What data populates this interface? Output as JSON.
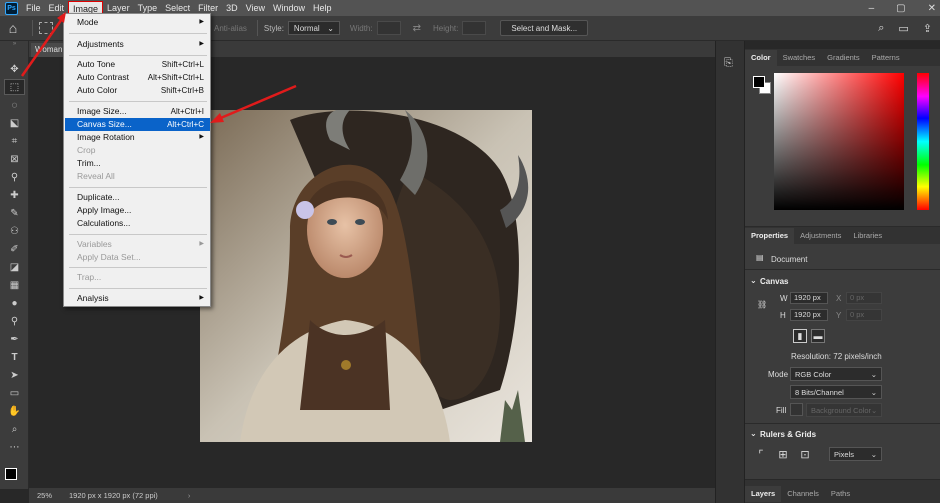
{
  "menubar": {
    "logo": "Ps",
    "items": [
      "File",
      "Edit",
      "Image",
      "Layer",
      "Type",
      "Select",
      "Filter",
      "3D",
      "View",
      "Window",
      "Help"
    ],
    "active_index": 2,
    "window_controls": [
      "–",
      "▢",
      "✕"
    ]
  },
  "options": {
    "anti_alias": "Anti-alias",
    "style_label": "Style:",
    "style_value": "Normal",
    "width_label": "Width:",
    "height_label": "Height:",
    "select_mask": "Select and Mask..."
  },
  "document": {
    "tab_title": "Woman",
    "zoom": "25%",
    "info": "1920 px x 1920 px (72 ppi)"
  },
  "image_menu": {
    "mode": "Mode",
    "adjustments": "Adjustments",
    "auto_tone": "Auto Tone",
    "auto_tone_sc": "Shift+Ctrl+L",
    "auto_contrast": "Auto Contrast",
    "auto_contrast_sc": "Alt+Shift+Ctrl+L",
    "auto_color": "Auto Color",
    "auto_color_sc": "Shift+Ctrl+B",
    "image_size": "Image Size...",
    "image_size_sc": "Alt+Ctrl+I",
    "canvas_size": "Canvas Size...",
    "canvas_size_sc": "Alt+Ctrl+C",
    "image_rotation": "Image Rotation",
    "crop": "Crop",
    "trim": "Trim...",
    "reveal_all": "Reveal All",
    "duplicate": "Duplicate...",
    "apply_image": "Apply Image...",
    "calculations": "Calculations...",
    "variables": "Variables",
    "apply_data_set": "Apply Data Set...",
    "trap": "Trap...",
    "analysis": "Analysis"
  },
  "color_panel": {
    "tabs": [
      "Color",
      "Swatches",
      "Gradients",
      "Patterns"
    ],
    "foreground": "#000000",
    "background": "#ffffff"
  },
  "properties_panel": {
    "tabs": [
      "Properties",
      "Adjustments",
      "Libraries"
    ],
    "doc_label": "Document",
    "canvas_title": "Canvas",
    "w_label": "W",
    "w_value": "1920 px",
    "h_label": "H",
    "h_value": "1920 px",
    "x_label": "X",
    "x_value": "0 px",
    "y_label": "Y",
    "y_value": "0 px",
    "resolution": "Resolution: 72 pixels/inch",
    "mode_label": "Mode",
    "mode_value": "RGB Color",
    "bits_value": "8 Bits/Channel",
    "fill_label": "Fill",
    "fill_value": "Background Color",
    "rulers_title": "Rulers & Grids",
    "units_value": "Pixels"
  },
  "layers_panel": {
    "tabs": [
      "Layers",
      "Channels",
      "Paths"
    ]
  }
}
